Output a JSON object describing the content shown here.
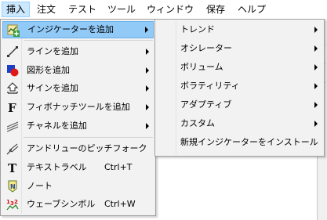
{
  "menubar": {
    "items": [
      {
        "label": "挿入",
        "active": true
      },
      {
        "label": "注文"
      },
      {
        "label": "テスト"
      },
      {
        "label": "ツール"
      },
      {
        "label": "ウィンドウ"
      },
      {
        "label": "保存"
      },
      {
        "label": "ヘルプ"
      }
    ]
  },
  "insert_menu": {
    "items": [
      {
        "label": "インジケーターを追加",
        "icon": "add-indicator-icon",
        "submenu": true,
        "highlighted": true
      },
      {
        "label": "ラインを追加",
        "icon": "line-icon",
        "submenu": true
      },
      {
        "label": "図形を追加",
        "icon": "shapes-icon",
        "submenu": true
      },
      {
        "label": "サインを追加",
        "icon": "sign-icon",
        "submenu": true
      },
      {
        "label": "フィボナッチツールを追加",
        "icon": "fibonacci-icon",
        "submenu": true
      },
      {
        "label": "チャネルを追加",
        "icon": "channel-icon",
        "submenu": true
      },
      {
        "label": "アンドリューのピッチフォーク",
        "icon": "pitchfork-icon"
      },
      {
        "label": "テキストラベル",
        "icon": "text-label-icon",
        "shortcut": "Ctrl+T"
      },
      {
        "label": "ノート",
        "icon": "note-icon"
      },
      {
        "label": "ウェーブシンボル",
        "icon": "wave-symbol-icon",
        "shortcut": "Ctrl+W"
      }
    ]
  },
  "indicator_submenu": {
    "items": [
      {
        "label": "トレンド",
        "submenu": true
      },
      {
        "label": "オシレーター",
        "submenu": true
      },
      {
        "label": "ボリューム",
        "submenu": true
      },
      {
        "label": "ボラティリティ",
        "submenu": true
      },
      {
        "label": "アダプティブ",
        "submenu": true
      },
      {
        "label": "カスタム",
        "submenu": true
      },
      {
        "label": "新規インジケーターをインストール"
      }
    ]
  },
  "colors": {
    "highlight": "#91c9f7",
    "menubar_active": "#cce8ff",
    "menu_background": "#f2f2f2"
  }
}
